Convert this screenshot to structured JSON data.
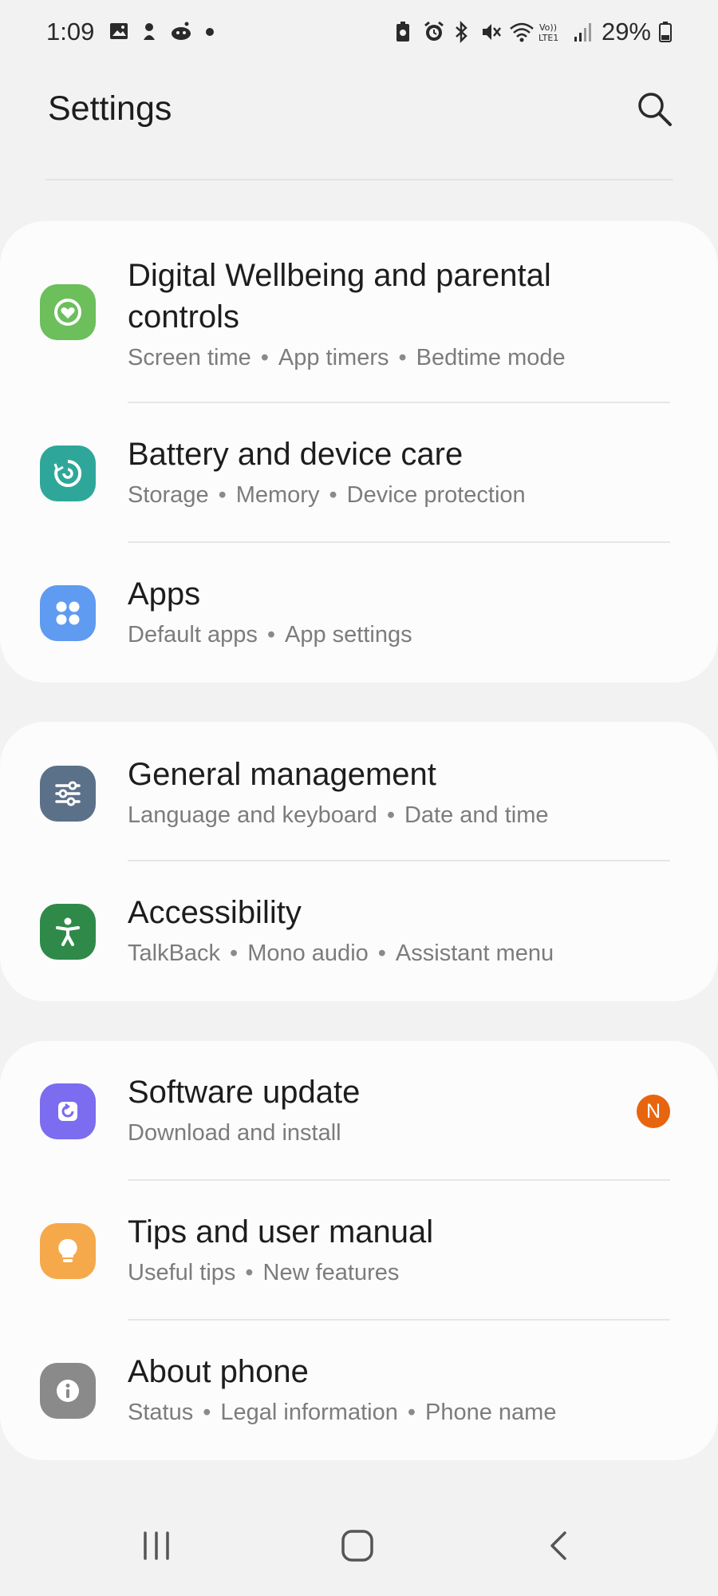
{
  "status_bar": {
    "time": "1:09",
    "battery": "29%",
    "left_icons": [
      "gallery-icon",
      "tool-icon",
      "reddit-icon",
      "dot-icon"
    ],
    "right_icons": [
      "battery-saver-icon",
      "alarm-icon",
      "bluetooth-icon",
      "mute-icon",
      "wifi-icon",
      "volte-icon",
      "signal-icon",
      "battery-icon"
    ],
    "volte_label": "Vo)) LTE1"
  },
  "header": {
    "title": "Settings",
    "search_icon": "search-icon"
  },
  "groups": [
    {
      "items": [
        {
          "title": "Digital Wellbeing and parental controls",
          "subtitle": [
            "Screen time",
            "App timers",
            "Bedtime mode"
          ],
          "icon": "wellbeing-icon",
          "icon_color": "#6cbf5b"
        },
        {
          "title": "Battery and device care",
          "subtitle": [
            "Storage",
            "Memory",
            "Device protection"
          ],
          "icon": "device-care-icon",
          "icon_color": "#2ea79a"
        },
        {
          "title": "Apps",
          "subtitle": [
            "Default apps",
            "App settings"
          ],
          "icon": "apps-icon",
          "icon_color": "#5f9bf0"
        }
      ]
    },
    {
      "items": [
        {
          "title": "General management",
          "subtitle": [
            "Language and keyboard",
            "Date and time"
          ],
          "icon": "sliders-icon",
          "icon_color": "#5b7189"
        },
        {
          "title": "Accessibility",
          "subtitle": [
            "TalkBack",
            "Mono audio",
            "Assistant menu"
          ],
          "icon": "accessibility-icon",
          "icon_color": "#2f8a4a"
        }
      ]
    },
    {
      "items": [
        {
          "title": "Software update",
          "subtitle": [
            "Download and install"
          ],
          "icon": "software-update-icon",
          "icon_color": "#7b6cf0",
          "badge": "N",
          "badge_color": "#e8650f"
        },
        {
          "title": "Tips and user manual",
          "subtitle": [
            "Useful tips",
            "New features"
          ],
          "icon": "lightbulb-icon",
          "icon_color": "#f5a94a"
        },
        {
          "title": "About phone",
          "subtitle": [
            "Status",
            "Legal information",
            "Phone name"
          ],
          "icon": "info-icon",
          "icon_color": "#8a8a8a"
        }
      ]
    }
  ],
  "nav_bar": {
    "recents": "recents-icon",
    "home": "home-icon",
    "back": "back-icon"
  }
}
